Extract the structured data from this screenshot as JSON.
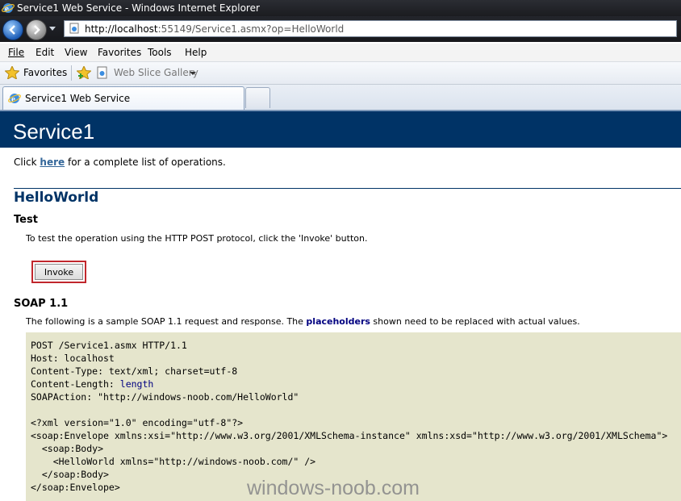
{
  "window": {
    "title": "Service1 Web Service - Windows Internet Explorer"
  },
  "address_bar": {
    "url_host": "http://localhost",
    "url_rest": ":55149/Service1.asmx?op=HelloWorld"
  },
  "menu": [
    "File",
    "Edit",
    "View",
    "Favorites",
    "Tools",
    "Help"
  ],
  "favorites_bar": {
    "favorites_label": "Favorites",
    "web_slice_label": "Web Slice Gallery"
  },
  "tabs": [
    {
      "label": "Service1 Web Service"
    }
  ],
  "page": {
    "service_name": "Service1",
    "intro_prefix": "Click ",
    "intro_link": "here",
    "intro_suffix": " for a complete list of operations.",
    "operation": "HelloWorld",
    "test_heading": "Test",
    "test_text": "To test the operation using the HTTP POST protocol, click the 'Invoke' button.",
    "invoke_label": "Invoke",
    "soap_heading": "SOAP 1.1",
    "soap_text_prefix": "The following is a sample SOAP 1.1 request and response. The ",
    "soap_text_bold": "placeholders",
    "soap_text_suffix": " shown need to be replaced with actual values.",
    "code_lines": [
      "POST /Service1.asmx HTTP/1.1",
      "Host: localhost",
      "Content-Type: text/xml; charset=utf-8",
      "Content-Length: ",
      "SOAPAction: \"http://windows-noob.com/HelloWorld\"",
      "",
      "<?xml version=\"1.0\" encoding=\"utf-8\"?>",
      "<soap:Envelope xmlns:xsi=\"http://www.w3.org/2001/XMLSchema-instance\" xmlns:xsd=\"http://www.w3.org/2001/XMLSchema\">",
      "  <soap:Body>",
      "    <HelloWorld xmlns=\"http://windows-noob.com/\" />",
      "  </soap:Body>",
      "</soap:Envelope>"
    ],
    "content_length_placeholder": "length",
    "watermark": "windows-noob.com"
  }
}
